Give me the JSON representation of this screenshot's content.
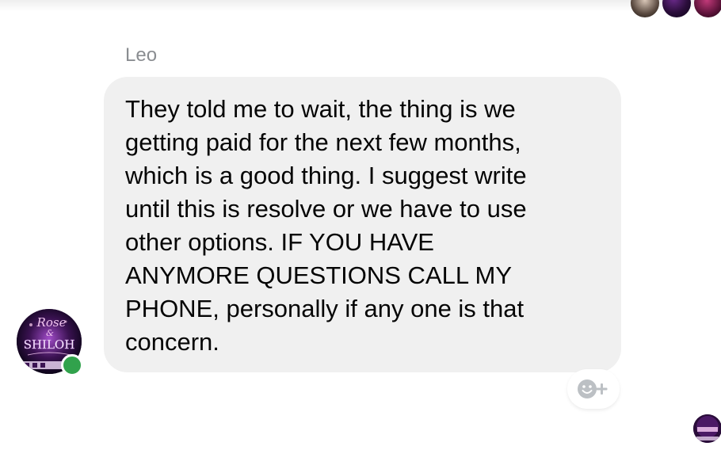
{
  "message": {
    "sender": "Leo",
    "lines": [
      "They told me to wait, the thing is we",
      "getting paid for the next few months,",
      "which is a good thing. I suggest write",
      "until this is resolve or we have to use",
      "other options. IF YOU HAVE",
      "ANYMORE QUESTIONS CALL MY",
      "PHONE, personally if any one is that",
      "concern."
    ]
  },
  "avatar": {
    "logo_line_1": "Rose",
    "logo_line_2": "&",
    "logo_line_3": "SHILOH",
    "online": true
  },
  "reaction": {
    "icon": "add-reaction-icon"
  },
  "colors": {
    "bubble": "#f0f0f0",
    "text": "#050505",
    "sender": "#8a8d91",
    "online": "#31a24c",
    "reaction_icon": "#bcc0c4"
  }
}
